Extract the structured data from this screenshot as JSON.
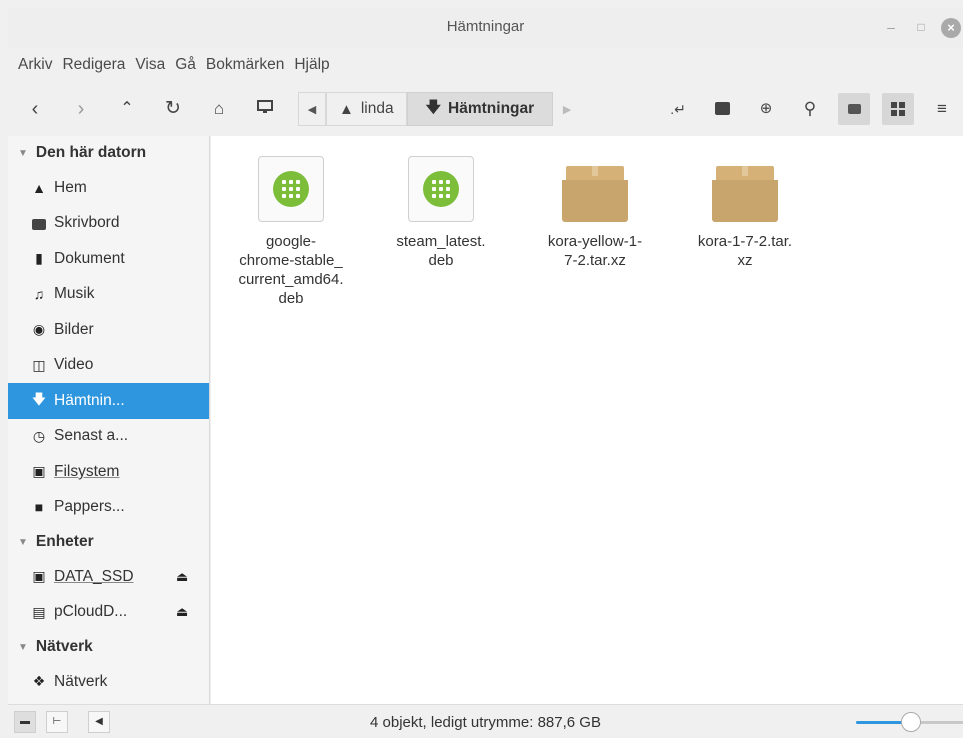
{
  "window": {
    "title": "Hämtningar",
    "minimize_glyph": "–",
    "maximize_glyph": "□",
    "close_glyph": "×"
  },
  "menubar": {
    "items": [
      "Arkiv",
      "Redigera",
      "Visa",
      "Gå",
      "Bokmärken",
      "Hjälp"
    ]
  },
  "toolbar": {
    "icons": [
      "back-icon",
      "forward-icon",
      "up-icon",
      "reload-icon",
      "home-icon",
      "computer-icon"
    ],
    "path": [
      {
        "label": "linda",
        "icon": "home-icon"
      },
      {
        "label": "Hämtningar",
        "icon": "download-icon",
        "active": true
      }
    ],
    "right_icons": [
      "toggle-location-icon",
      "terminal-icon",
      "new-folder-icon",
      "search-icon",
      "icon-view-icon",
      "compact-view-icon",
      "list-view-icon"
    ]
  },
  "sidebar": {
    "sections": [
      {
        "label": "Den här datorn",
        "items": [
          {
            "label": "Hem",
            "icon": "home-icon"
          },
          {
            "label": "Skrivbord",
            "icon": "desktop-icon"
          },
          {
            "label": "Dokument",
            "icon": "document-icon"
          },
          {
            "label": "Musik",
            "icon": "music-icon"
          },
          {
            "label": "Bilder",
            "icon": "camera-icon"
          },
          {
            "label": "Video",
            "icon": "film-icon"
          },
          {
            "label": "Hämtnin...",
            "icon": "download-icon",
            "selected": true
          },
          {
            "label": "Senast a...",
            "icon": "clock-icon"
          },
          {
            "label": "Filsystem",
            "icon": "drive-icon",
            "underline": true
          },
          {
            "label": "Pappers...",
            "icon": "trash-icon"
          }
        ]
      },
      {
        "label": "Enheter",
        "items": [
          {
            "label": "DATA_SSD",
            "icon": "drive-icon",
            "underline": true,
            "eject": true
          },
          {
            "label": "pCloudD...",
            "icon": "removable-drive-icon",
            "eject": true
          }
        ]
      },
      {
        "label": "Nätverk",
        "items": [
          {
            "label": "Nätverk",
            "icon": "network-icon"
          }
        ]
      }
    ]
  },
  "files": [
    {
      "name": "google-\nchrome-stable_\ncurrent_amd64.\ndeb",
      "type": "deb"
    },
    {
      "name": "steam_latest.\ndeb",
      "type": "deb"
    },
    {
      "name": "kora-yellow-1-\n7-2.tar.xz",
      "type": "archive"
    },
    {
      "name": "kora-1-7-2.tar.\nxz",
      "type": "archive"
    }
  ],
  "statusbar": {
    "text": "4 objekt, ledigt utrymme: 887,6 GB",
    "zoom_level": 0.5
  },
  "colors": {
    "accent": "#2e96de",
    "deb_green": "#7cbd3a",
    "archive_brown": "#c9a56e"
  }
}
